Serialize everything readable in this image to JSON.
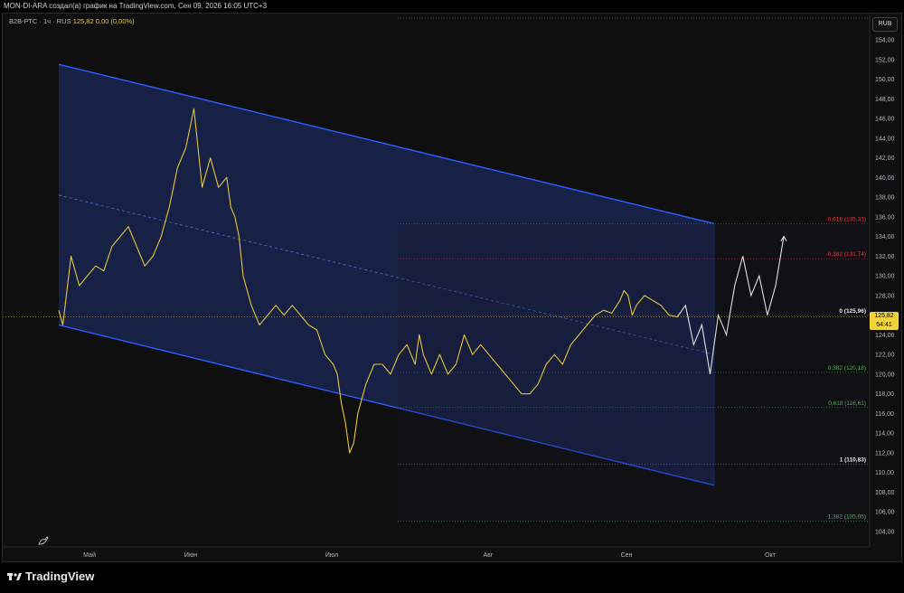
{
  "header": {
    "title": "MON-DI-ARA создал(а) график на TradingView.com, Сен 09, 2026 16:05 UTC+3"
  },
  "legend": {
    "symbol": "B2B-РТС · 1ч · RUS",
    "price": "125,82",
    "change": "0,00 (0,00%)"
  },
  "price_tag": {
    "price": "125,82",
    "countdown": "54:41"
  },
  "currency": "RUB",
  "brand": {
    "name": "TradingView"
  },
  "colors": {
    "price_line": "#e8c43c",
    "channel": "#2d5bff",
    "forecast": "#e0e0e0",
    "fib_red": "#f23645",
    "fib_green": "#4caf50"
  },
  "chart_data": {
    "type": "line",
    "title": "",
    "ylim": [
      103,
      156
    ],
    "y_ticks": [
      "104,00",
      "106,00",
      "108,00",
      "110,00",
      "112,00",
      "114,00",
      "116,00",
      "118,00",
      "120,00",
      "122,00",
      "124,00",
      "126,00",
      "128,00",
      "130,00",
      "132,00",
      "134,00",
      "136,00",
      "138,00",
      "140,00",
      "142,00",
      "144,00",
      "146,00",
      "148,00",
      "150,00",
      "152,00",
      "154,00"
    ],
    "x_ticks": [
      "Май",
      "Июн",
      "Июл",
      "Авг",
      "Сен",
      "Окт"
    ],
    "series": [
      {
        "x": [
          0,
          1,
          3,
          5,
          7,
          9,
          11,
          13,
          15,
          17,
          19,
          21,
          23,
          25,
          27,
          29,
          31,
          33,
          35,
          37,
          39,
          41,
          42,
          43,
          44,
          45,
          47,
          49,
          51,
          53,
          55,
          57,
          59,
          61,
          63,
          65,
          67,
          68,
          69,
          70,
          71,
          72,
          73,
          75,
          77,
          79,
          81,
          83,
          85,
          87,
          88,
          89,
          90,
          91,
          93,
          95,
          97,
          99,
          101,
          103,
          105,
          107,
          109,
          111,
          113,
          115,
          117,
          119,
          121,
          123,
          125,
          127,
          129,
          131,
          133,
          135,
          137,
          138,
          139,
          140,
          141,
          143,
          145,
          147,
          149,
          151
        ],
        "values": [
          126.5,
          125,
          132,
          129,
          130,
          131,
          130.5,
          133,
          134,
          135,
          133,
          131,
          132,
          134,
          137,
          141,
          143,
          147,
          139,
          142,
          139,
          140,
          137,
          136,
          134,
          130,
          127,
          125,
          126,
          127,
          126,
          127,
          126,
          125,
          124.5,
          122,
          121,
          120,
          117,
          115,
          112,
          113,
          116,
          119,
          121,
          121,
          120,
          122,
          123,
          121,
          124,
          122,
          121,
          120,
          122,
          120,
          121,
          124,
          122,
          123,
          122,
          121,
          120,
          119,
          118,
          118,
          119,
          121,
          122,
          121,
          123,
          124,
          125,
          126,
          126.5,
          126.2,
          127.5,
          128.5,
          128,
          126,
          127,
          128,
          127.5,
          127,
          126,
          125.82
        ]
      }
    ],
    "forecast": {
      "x": [
        151,
        153,
        155,
        157,
        159,
        161,
        163,
        165,
        167,
        169,
        171,
        173,
        175,
        177
      ],
      "values": [
        125.82,
        127,
        123,
        125,
        120,
        126,
        124,
        129,
        132,
        128,
        130,
        126,
        129,
        134
      ]
    },
    "channel": {
      "upper": [
        [
          0,
          151.5
        ],
        [
          160,
          135.3
        ]
      ],
      "lower": [
        [
          0,
          125
        ],
        [
          160,
          108.7
        ]
      ],
      "mid": [
        [
          0,
          138.2
        ],
        [
          160,
          122
        ]
      ]
    },
    "fib_levels": [
      {
        "label": "-0,618 (135,31)",
        "value": 135.31
      },
      {
        "label": "-0,382 (131,74)",
        "value": 131.74
      },
      {
        "label": "0 (125,96)",
        "value": 125.96
      },
      {
        "label": "0,382 (120,18)",
        "value": 120.18
      },
      {
        "label": "0,618 (116,61)",
        "value": 116.61
      },
      {
        "label": "1 (110,83)",
        "value": 110.83
      },
      {
        "label": "1,382 (105,05)",
        "value": 105.05
      }
    ]
  }
}
